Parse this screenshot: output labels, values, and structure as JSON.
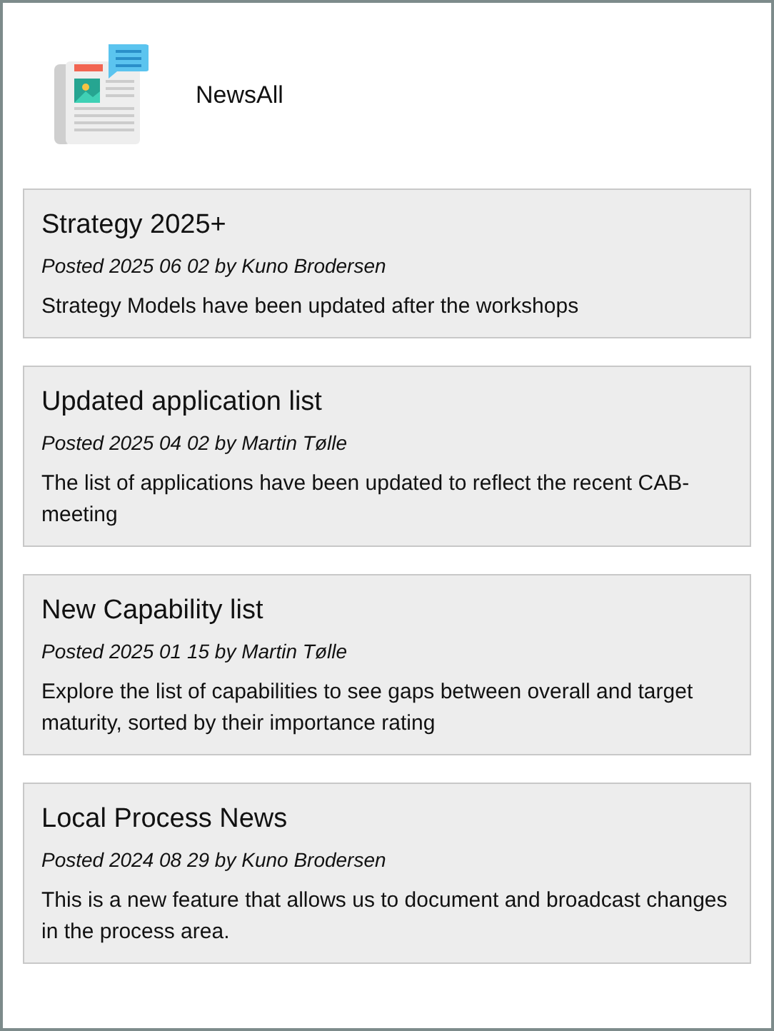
{
  "app": {
    "title": "NewsAll"
  },
  "posts": [
    {
      "title": "Strategy 2025+",
      "meta": "Posted 2025 06 02 by Kuno Brodersen",
      "body": "Strategy Models have been updated after the workshops"
    },
    {
      "title": "Updated application list",
      "meta": "Posted 2025 04 02 by Martin Tølle",
      "body": "The list of applications have been updated to reflect the recent CAB-meeting"
    },
    {
      "title": "New Capability list",
      "meta": "Posted 2025 01 15 by Martin Tølle",
      "body": "Explore the list of capabilities to see gaps between overall and target maturity, sorted by their importance rating"
    },
    {
      "title": "Local Process News",
      "meta": "Posted 2024 08 29 by Kuno Brodersen",
      "body": "This is a new feature that allows us to document and broadcast changes in the process area."
    }
  ]
}
